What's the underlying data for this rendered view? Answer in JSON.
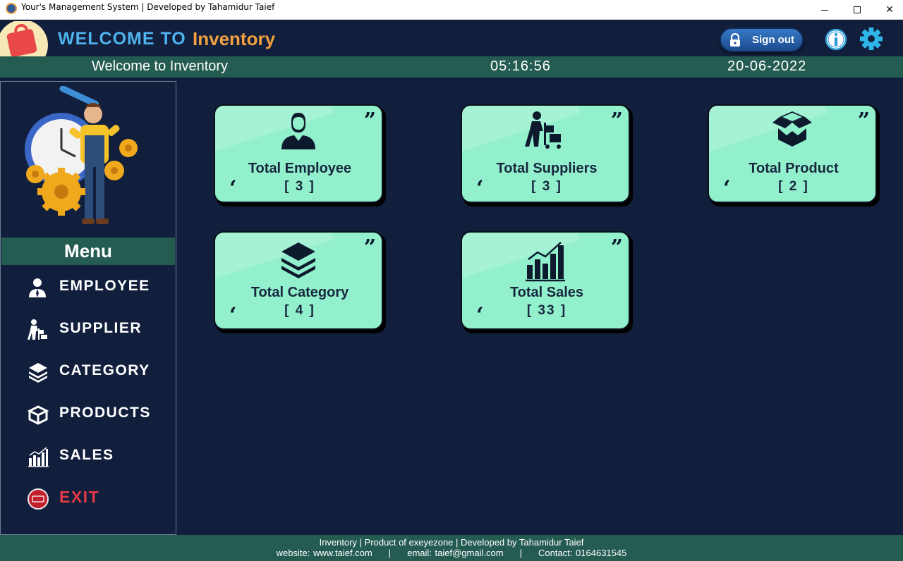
{
  "window": {
    "title": "Your's Management System | Developed by Tahamidur Taief",
    "minimize_glyph": "",
    "close_glyph": "✕"
  },
  "header": {
    "welcome_prefix": "WELCOME TO",
    "app_name": "Inventory",
    "signout_label": "Sign out"
  },
  "status": {
    "welcome_text": "Welcome to Inventory",
    "time": "05:16:56",
    "date": "20-06-2022"
  },
  "sidebar": {
    "menu_title": "Menu",
    "items": [
      {
        "label": "EMPLOYEE",
        "icon": "employee-icon"
      },
      {
        "label": "SUPPLIER",
        "icon": "supplier-icon"
      },
      {
        "label": "CATEGORY",
        "icon": "category-icon"
      },
      {
        "label": "PRODUCTS",
        "icon": "products-icon"
      },
      {
        "label": "SALES",
        "icon": "sales-icon"
      },
      {
        "label": "EXIT",
        "icon": "exit-icon"
      }
    ]
  },
  "cards": [
    {
      "title": "Total Employee",
      "value": "[ 3 ]",
      "icon": "employee-icon"
    },
    {
      "title": "Total Suppliers",
      "value": "[ 3 ]",
      "icon": "supplier-icon"
    },
    {
      "title": "Total Product",
      "value": "[ 2 ]",
      "icon": "box-icon"
    },
    {
      "title": "Total Category",
      "value": "[ 4 ]",
      "icon": "layers-icon"
    },
    {
      "title": "Total Sales",
      "value": "[ 33 ]",
      "icon": "bar-chart-icon"
    }
  ],
  "footer": {
    "line1": "Inventory | Product of exeyezone  |  Developed by Tahamidur Taief",
    "line2": "website: www.taief.com     |     email: taief@gmail.com     |     Contact: 0164631545"
  },
  "colors": {
    "background": "#111f3c",
    "accent_green": "#255c52",
    "card": "#92f0cc",
    "welcome_blue": "#4fb2ee",
    "app_orange": "#f2a040",
    "exit_red": "#e53a45"
  }
}
